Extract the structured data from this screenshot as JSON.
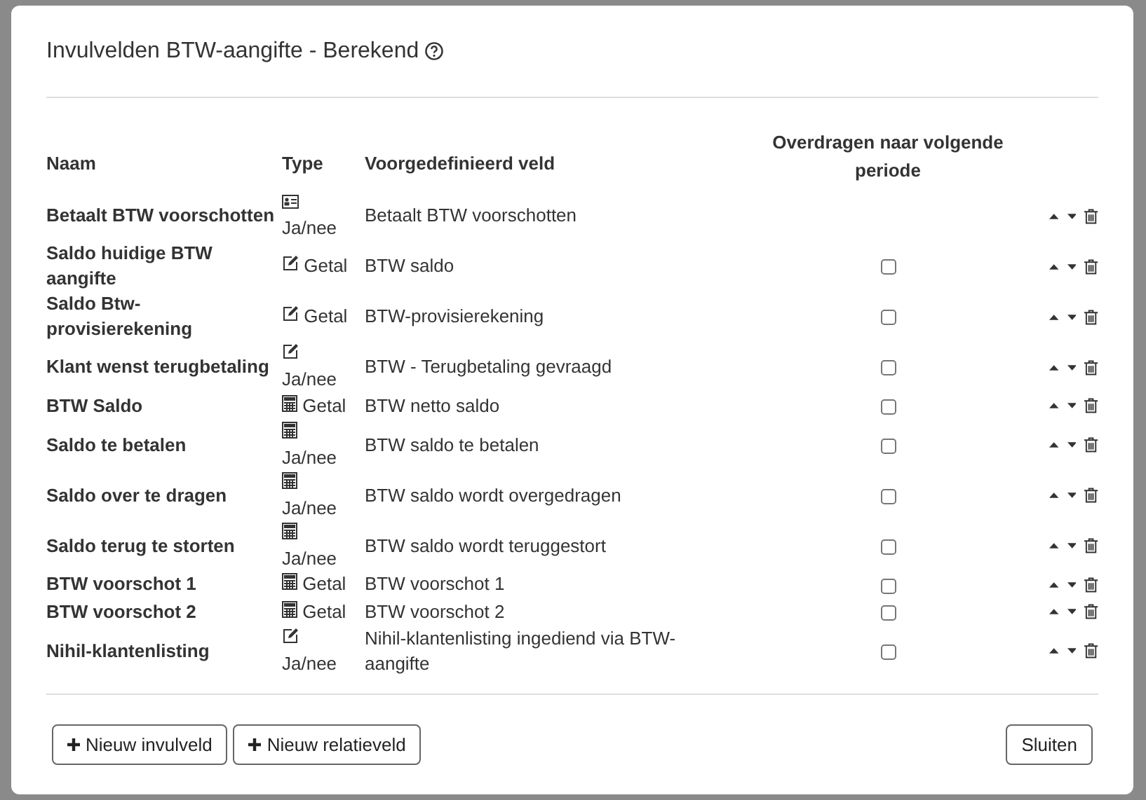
{
  "dialog": {
    "title": "Invulvelden BTW-aangifte - Berekend"
  },
  "table": {
    "columns": [
      "Naam",
      "Type",
      "Voorgedefinieerd veld",
      "Overdragen naar volgende periode"
    ],
    "rows": [
      {
        "name": "Betaalt BTW voorschotten",
        "kind": "card",
        "type": "Ja/nee",
        "field": "Betaalt BTW voorschotten"
      },
      {
        "name": "Saldo huidige BTW aangifte",
        "kind": "edit",
        "type": "Getal",
        "field": "BTW saldo",
        "checked": false
      },
      {
        "name": "Saldo Btw-provisierekening",
        "kind": "edit",
        "type": "Getal",
        "field": "BTW-provisierekening",
        "checked": false
      },
      {
        "name": "Klant wenst terugbetaling",
        "kind": "edit",
        "type": "Ja/nee",
        "field": "BTW - Terugbetaling gevraagd",
        "checked": false
      },
      {
        "name": "BTW Saldo",
        "kind": "calculator",
        "type": "Getal",
        "field": "BTW netto saldo",
        "checked": false
      },
      {
        "name": "Saldo te betalen",
        "kind": "calculator",
        "type": "Ja/nee",
        "field": "BTW saldo te betalen",
        "checked": false
      },
      {
        "name": "Saldo over te dragen",
        "kind": "calculator",
        "type": "Ja/nee",
        "field": "BTW saldo wordt overgedragen",
        "checked": false
      },
      {
        "name": "Saldo terug te storten",
        "kind": "calculator",
        "type": "Ja/nee",
        "field": "BTW saldo wordt teruggestort",
        "checked": false
      },
      {
        "name": "BTW voorschot 1",
        "kind": "calculator",
        "type": "Getal",
        "field": "BTW voorschot 1",
        "checked": false
      },
      {
        "name": "BTW voorschot 2",
        "kind": "calculator",
        "type": "Getal",
        "field": "BTW voorschot 2",
        "checked": false
      },
      {
        "name": "Nihil-klantenlisting",
        "kind": "edit",
        "type": "Ja/nee",
        "field": "Nihil-klantenlisting ingediend via BTW-aangifte",
        "checked": false
      }
    ]
  },
  "buttons": [
    "Nieuw invulveld",
    "Nieuw relatieveld"
  ],
  "close_button": "Sluiten"
}
